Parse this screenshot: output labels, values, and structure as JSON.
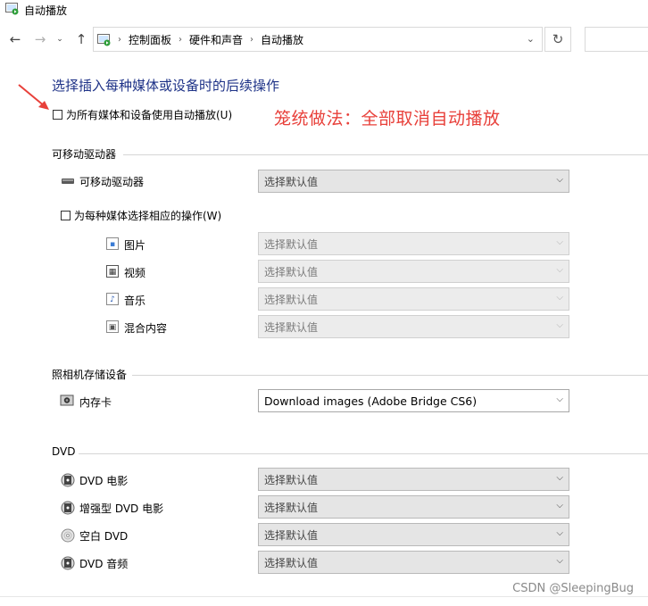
{
  "window": {
    "title": "自动播放"
  },
  "nav": {
    "back_icon": "arrow-left",
    "forward_icon": "arrow-right",
    "recent_icon": "chevron-down",
    "up_icon": "arrow-up",
    "refresh_icon": "refresh"
  },
  "breadcrumb": [
    "控制面板",
    "硬件和声音",
    "自动播放"
  ],
  "heading": "选择插入每种媒体或设备时的后续操作",
  "use_autoplay_all": {
    "label": "为所有媒体和设备使用自动播放(U)",
    "checked": false
  },
  "annotation": "笼统做法：全部取消自动播放",
  "annotation_color": "#e8403a",
  "sections": {
    "removable": {
      "title": "可移动驱动器",
      "drive": {
        "label": "可移动驱动器",
        "value": "选择默认值"
      },
      "per_media": {
        "label": "为每种媒体选择相应的操作(W)",
        "checked": false
      },
      "media": [
        {
          "label": "图片",
          "value": "选择默认值"
        },
        {
          "label": "视频",
          "value": "选择默认值"
        },
        {
          "label": "音乐",
          "value": "选择默认值"
        },
        {
          "label": "混合内容",
          "value": "选择默认值"
        }
      ]
    },
    "camera": {
      "title": "照相机存储设备",
      "items": [
        {
          "label": "内存卡",
          "value": "Download images (Adobe Bridge CS6)"
        }
      ]
    },
    "dvd": {
      "title": "DVD",
      "items": [
        {
          "label": "DVD 电影",
          "value": "选择默认值"
        },
        {
          "label": "增强型 DVD 电影",
          "value": "选择默认值"
        },
        {
          "label": "空白 DVD",
          "value": "选择默认值"
        },
        {
          "label": "DVD 音频",
          "value": "选择默认值"
        }
      ]
    }
  },
  "watermark": "CSDN @SleepingBug"
}
